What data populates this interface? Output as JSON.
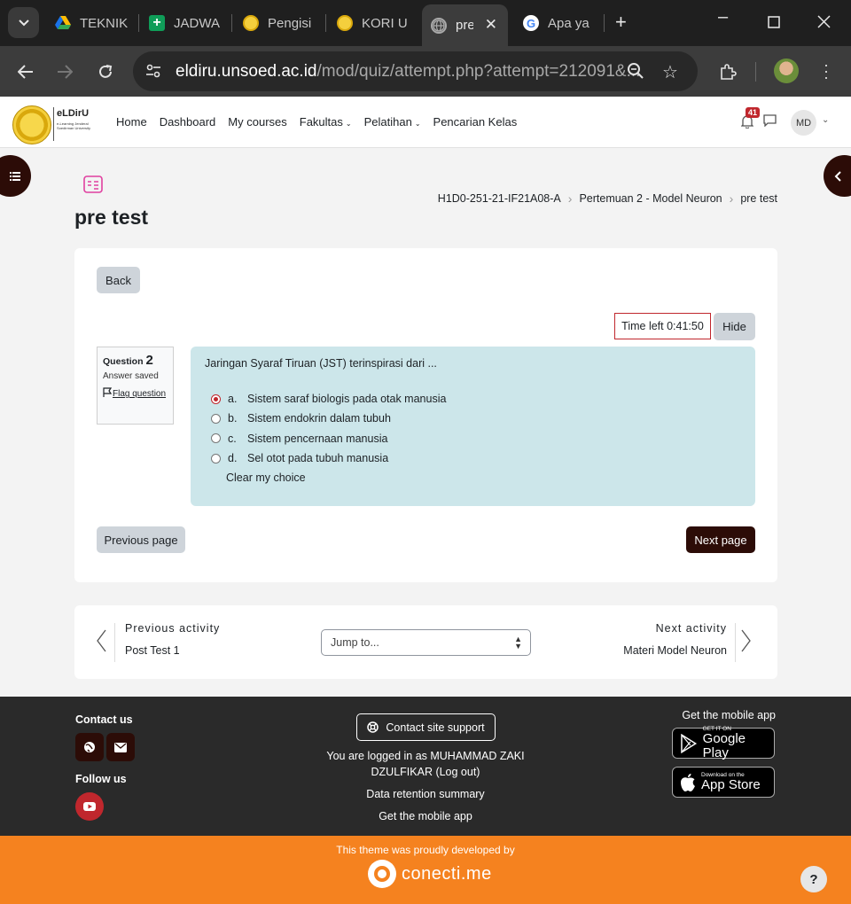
{
  "browser": {
    "tabs": [
      {
        "title": "TEKNIK",
        "icon": "google-drive-icon"
      },
      {
        "title": "JADWA",
        "icon": "google-sheets-icon"
      },
      {
        "title": "Pengisi",
        "icon": "unsoed-seal-icon"
      },
      {
        "title": "KORI U",
        "icon": "unsoed-seal-icon"
      },
      {
        "title": "pre",
        "icon": "globe-icon",
        "active": true
      },
      {
        "title": "Apa ya",
        "icon": "google-icon"
      }
    ],
    "url_host": "eldiru.unsoed.ac.id",
    "url_path": "/mod/quiz/attempt.php?attempt=212091&..."
  },
  "site": {
    "logo_name": "eLDirU",
    "logo_sub": "e-Learning Jenderal Soedirman University",
    "nav": [
      "Home",
      "Dashboard",
      "My courses",
      "Fakultas",
      "Pelatihan",
      "Pencarian Kelas"
    ],
    "notification_count": "41",
    "user_initials": "MD"
  },
  "breadcrumb": [
    "H1D0-251-21-IF21A08-A",
    "Pertemuan 2 - Model Neuron",
    "pre test"
  ],
  "page_title": "pre test",
  "quiz": {
    "back_label": "Back",
    "timer": "Time left 0:41:50",
    "hide_label": "Hide",
    "question_label": "Question",
    "question_number": "2",
    "question_state": "Answer saved",
    "flag_label": "Flag question",
    "question_text": "Jaringan Syaraf Tiruan (JST) terinspirasi dari ...",
    "answers": [
      {
        "letter": "a.",
        "text": "Sistem saraf biologis pada otak manusia",
        "selected": true
      },
      {
        "letter": "b.",
        "text": "Sistem endokrin dalam tubuh",
        "selected": false
      },
      {
        "letter": "c.",
        "text": "Sistem pencernaan manusia",
        "selected": false
      },
      {
        "letter": "d.",
        "text": "Sel otot pada tubuh manusia",
        "selected": false
      }
    ],
    "clear_label": "Clear my choice",
    "prev_page": "Previous page",
    "next_page": "Next page"
  },
  "activity_nav": {
    "prev_label": "Previous activity",
    "prev_name": "Post Test 1",
    "jump_placeholder": "Jump to...",
    "next_label": "Next activity",
    "next_name": "Materi Model Neuron"
  },
  "footer": {
    "contact_us": "Contact us",
    "follow_us": "Follow us",
    "support_button": "Contact site support",
    "logged_in_line1": "You are logged in as MUHAMMAD ZAKI",
    "logged_in_line2": "DZULFIKAR (Log out)",
    "data_retention": "Data retention summary",
    "get_mobile_app_link": "Get the mobile app",
    "get_mobile_app_title": "Get the mobile app",
    "google_play_small": "GET IT ON",
    "google_play_big": "Google Play",
    "app_store_small": "Download on the",
    "app_store_big": "App Store"
  },
  "brandbar": {
    "tagline": "This theme was proudly developed by",
    "brand": "conecti.me",
    "help": "?"
  },
  "colors": {
    "brand_dark": "#2c0c07",
    "accent_red": "#c0272d",
    "question_bg": "#cce6ea",
    "footer_bg": "#2a2a2a",
    "brandbar_bg": "#f5821f"
  }
}
